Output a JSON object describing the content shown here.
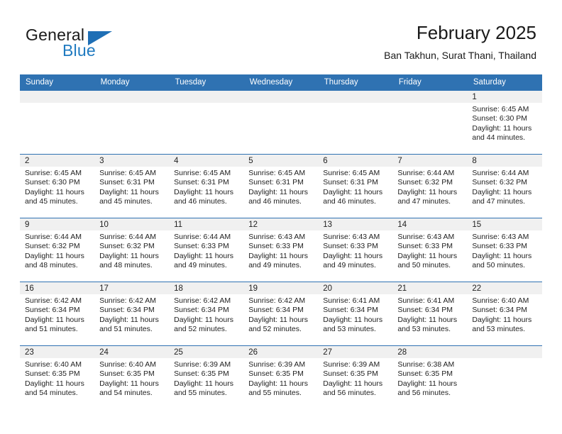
{
  "brand": {
    "name_part1": "General",
    "name_part2": "Blue",
    "triangle_color": "#1f6fb5",
    "blue_color": "#1f7ac0"
  },
  "header": {
    "title": "February 2025",
    "subtitle": "Ban Takhun, Surat Thani, Thailand"
  },
  "theme": {
    "header_blue": "#2f72b2",
    "daynum_band": "#f0f0f0",
    "text": "#222222"
  },
  "weekday_headers": [
    "Sunday",
    "Monday",
    "Tuesday",
    "Wednesday",
    "Thursday",
    "Friday",
    "Saturday"
  ],
  "weeks": [
    [
      {
        "day": "",
        "sunrise": "",
        "sunset": "",
        "daylight_line1": "",
        "daylight_line2": "",
        "empty": true
      },
      {
        "day": "",
        "sunrise": "",
        "sunset": "",
        "daylight_line1": "",
        "daylight_line2": "",
        "empty": true
      },
      {
        "day": "",
        "sunrise": "",
        "sunset": "",
        "daylight_line1": "",
        "daylight_line2": "",
        "empty": true
      },
      {
        "day": "",
        "sunrise": "",
        "sunset": "",
        "daylight_line1": "",
        "daylight_line2": "",
        "empty": true
      },
      {
        "day": "",
        "sunrise": "",
        "sunset": "",
        "daylight_line1": "",
        "daylight_line2": "",
        "empty": true
      },
      {
        "day": "",
        "sunrise": "",
        "sunset": "",
        "daylight_line1": "",
        "daylight_line2": "",
        "empty": true
      },
      {
        "day": "1",
        "sunrise": "Sunrise: 6:45 AM",
        "sunset": "Sunset: 6:30 PM",
        "daylight_line1": "Daylight: 11 hours",
        "daylight_line2": "and 44 minutes."
      }
    ],
    [
      {
        "day": "2",
        "sunrise": "Sunrise: 6:45 AM",
        "sunset": "Sunset: 6:30 PM",
        "daylight_line1": "Daylight: 11 hours",
        "daylight_line2": "and 45 minutes."
      },
      {
        "day": "3",
        "sunrise": "Sunrise: 6:45 AM",
        "sunset": "Sunset: 6:31 PM",
        "daylight_line1": "Daylight: 11 hours",
        "daylight_line2": "and 45 minutes."
      },
      {
        "day": "4",
        "sunrise": "Sunrise: 6:45 AM",
        "sunset": "Sunset: 6:31 PM",
        "daylight_line1": "Daylight: 11 hours",
        "daylight_line2": "and 46 minutes."
      },
      {
        "day": "5",
        "sunrise": "Sunrise: 6:45 AM",
        "sunset": "Sunset: 6:31 PM",
        "daylight_line1": "Daylight: 11 hours",
        "daylight_line2": "and 46 minutes."
      },
      {
        "day": "6",
        "sunrise": "Sunrise: 6:45 AM",
        "sunset": "Sunset: 6:31 PM",
        "daylight_line1": "Daylight: 11 hours",
        "daylight_line2": "and 46 minutes."
      },
      {
        "day": "7",
        "sunrise": "Sunrise: 6:44 AM",
        "sunset": "Sunset: 6:32 PM",
        "daylight_line1": "Daylight: 11 hours",
        "daylight_line2": "and 47 minutes."
      },
      {
        "day": "8",
        "sunrise": "Sunrise: 6:44 AM",
        "sunset": "Sunset: 6:32 PM",
        "daylight_line1": "Daylight: 11 hours",
        "daylight_line2": "and 47 minutes."
      }
    ],
    [
      {
        "day": "9",
        "sunrise": "Sunrise: 6:44 AM",
        "sunset": "Sunset: 6:32 PM",
        "daylight_line1": "Daylight: 11 hours",
        "daylight_line2": "and 48 minutes."
      },
      {
        "day": "10",
        "sunrise": "Sunrise: 6:44 AM",
        "sunset": "Sunset: 6:32 PM",
        "daylight_line1": "Daylight: 11 hours",
        "daylight_line2": "and 48 minutes."
      },
      {
        "day": "11",
        "sunrise": "Sunrise: 6:44 AM",
        "sunset": "Sunset: 6:33 PM",
        "daylight_line1": "Daylight: 11 hours",
        "daylight_line2": "and 49 minutes."
      },
      {
        "day": "12",
        "sunrise": "Sunrise: 6:43 AM",
        "sunset": "Sunset: 6:33 PM",
        "daylight_line1": "Daylight: 11 hours",
        "daylight_line2": "and 49 minutes."
      },
      {
        "day": "13",
        "sunrise": "Sunrise: 6:43 AM",
        "sunset": "Sunset: 6:33 PM",
        "daylight_line1": "Daylight: 11 hours",
        "daylight_line2": "and 49 minutes."
      },
      {
        "day": "14",
        "sunrise": "Sunrise: 6:43 AM",
        "sunset": "Sunset: 6:33 PM",
        "daylight_line1": "Daylight: 11 hours",
        "daylight_line2": "and 50 minutes."
      },
      {
        "day": "15",
        "sunrise": "Sunrise: 6:43 AM",
        "sunset": "Sunset: 6:33 PM",
        "daylight_line1": "Daylight: 11 hours",
        "daylight_line2": "and 50 minutes."
      }
    ],
    [
      {
        "day": "16",
        "sunrise": "Sunrise: 6:42 AM",
        "sunset": "Sunset: 6:34 PM",
        "daylight_line1": "Daylight: 11 hours",
        "daylight_line2": "and 51 minutes."
      },
      {
        "day": "17",
        "sunrise": "Sunrise: 6:42 AM",
        "sunset": "Sunset: 6:34 PM",
        "daylight_line1": "Daylight: 11 hours",
        "daylight_line2": "and 51 minutes."
      },
      {
        "day": "18",
        "sunrise": "Sunrise: 6:42 AM",
        "sunset": "Sunset: 6:34 PM",
        "daylight_line1": "Daylight: 11 hours",
        "daylight_line2": "and 52 minutes."
      },
      {
        "day": "19",
        "sunrise": "Sunrise: 6:42 AM",
        "sunset": "Sunset: 6:34 PM",
        "daylight_line1": "Daylight: 11 hours",
        "daylight_line2": "and 52 minutes."
      },
      {
        "day": "20",
        "sunrise": "Sunrise: 6:41 AM",
        "sunset": "Sunset: 6:34 PM",
        "daylight_line1": "Daylight: 11 hours",
        "daylight_line2": "and 53 minutes."
      },
      {
        "day": "21",
        "sunrise": "Sunrise: 6:41 AM",
        "sunset": "Sunset: 6:34 PM",
        "daylight_line1": "Daylight: 11 hours",
        "daylight_line2": "and 53 minutes."
      },
      {
        "day": "22",
        "sunrise": "Sunrise: 6:40 AM",
        "sunset": "Sunset: 6:34 PM",
        "daylight_line1": "Daylight: 11 hours",
        "daylight_line2": "and 53 minutes."
      }
    ],
    [
      {
        "day": "23",
        "sunrise": "Sunrise: 6:40 AM",
        "sunset": "Sunset: 6:35 PM",
        "daylight_line1": "Daylight: 11 hours",
        "daylight_line2": "and 54 minutes."
      },
      {
        "day": "24",
        "sunrise": "Sunrise: 6:40 AM",
        "sunset": "Sunset: 6:35 PM",
        "daylight_line1": "Daylight: 11 hours",
        "daylight_line2": "and 54 minutes."
      },
      {
        "day": "25",
        "sunrise": "Sunrise: 6:39 AM",
        "sunset": "Sunset: 6:35 PM",
        "daylight_line1": "Daylight: 11 hours",
        "daylight_line2": "and 55 minutes."
      },
      {
        "day": "26",
        "sunrise": "Sunrise: 6:39 AM",
        "sunset": "Sunset: 6:35 PM",
        "daylight_line1": "Daylight: 11 hours",
        "daylight_line2": "and 55 minutes."
      },
      {
        "day": "27",
        "sunrise": "Sunrise: 6:39 AM",
        "sunset": "Sunset: 6:35 PM",
        "daylight_line1": "Daylight: 11 hours",
        "daylight_line2": "and 56 minutes."
      },
      {
        "day": "28",
        "sunrise": "Sunrise: 6:38 AM",
        "sunset": "Sunset: 6:35 PM",
        "daylight_line1": "Daylight: 11 hours",
        "daylight_line2": "and 56 minutes."
      },
      {
        "day": "",
        "sunrise": "",
        "sunset": "",
        "daylight_line1": "",
        "daylight_line2": "",
        "empty": true
      }
    ]
  ]
}
